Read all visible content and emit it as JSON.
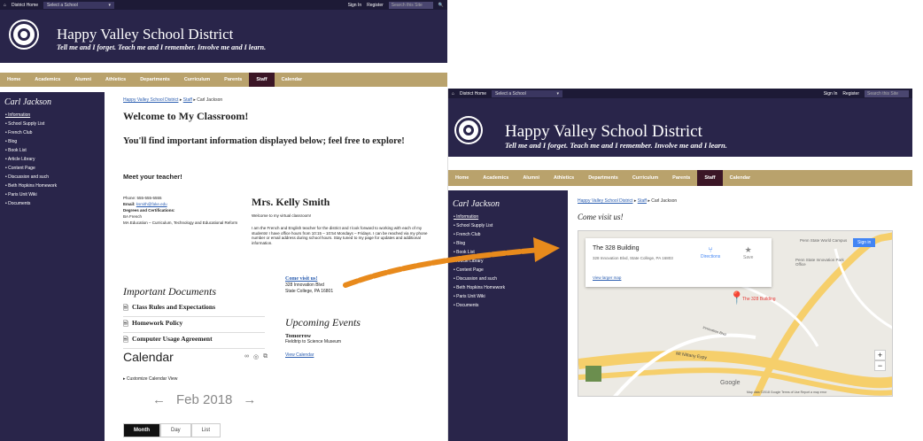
{
  "topbar": {
    "district_home": "District Home",
    "select_school": "Select a School",
    "sign_in": "Sign In",
    "register": "Register",
    "search_placeholder": "Search this Site"
  },
  "banner": {
    "title": "Happy Valley School District",
    "tagline": "Tell me and I forget. Teach me and I remember. Involve me and I learn."
  },
  "nav": [
    "Home",
    "Academics",
    "Alumni",
    "Athletics",
    "Departments",
    "Curriculum",
    "Parents",
    "Staff",
    "Calendar"
  ],
  "sidebar": {
    "title": "Carl Jackson",
    "items": [
      "Information",
      "School Supply List",
      "French Club",
      "Blog",
      "Book List",
      "Article Library",
      "Content Page",
      "Discussion and such",
      "Beth Hopkins Homework",
      "Paris Unit Wiki",
      "Documents"
    ]
  },
  "breadcrumb": {
    "root": "Happy Valley School District",
    "sep": "▸",
    "staff": "Staff",
    "current": "Carl Jackson"
  },
  "classroom": {
    "welcome": "Welcome to My Classroom!",
    "info_heading": "You'll find important information displayed below; feel free to explore!",
    "meet": "Meet your teacher!",
    "phone": "Phone: 555-555-5555",
    "email_label": "Email:",
    "email": "ksmith@fake.edu",
    "degrees": "Degrees and Certifications:",
    "degree1": "BA French",
    "degree2": "MA Education – Curriculum, Technology and Educational Reform",
    "teacher_name": "Mrs. Kelly Smith",
    "welcome_msg": "Welcome to my virtual classroom!",
    "bio": "I am the French and English teacher for the district and I look forward to working with each of my students! I have office hours from 10:15 – 10:54 Mondays – Fridays. I can be reached via my phone number or email address during school hours. Stay tuned to my page for updates and additional information."
  },
  "visit": {
    "link": "Come visit us!",
    "addr1": "328 Innovation Blvd",
    "addr2": "State College, PA 16801"
  },
  "documents": {
    "heading": "Important Documents",
    "items": [
      "Class Rules and Expectations",
      "Homework Policy",
      "Computer Usage Agreement"
    ]
  },
  "events": {
    "heading": "Upcoming Events",
    "day": "Tomorrow",
    "event": "Fieldtrip to Science Museum",
    "link": "View Calendar"
  },
  "calendar": {
    "heading": "Calendar",
    "customize": "Customize Calendar View",
    "prev": "←",
    "month": "Feb 2018",
    "next": "→",
    "views": [
      "Month",
      "Day",
      "List"
    ]
  },
  "map": {
    "place": "The 328 Building",
    "address": "328 Innovation Blvd, State College, PA 16803",
    "directions": "Directions",
    "save": "Save",
    "view_larger": "View larger map",
    "sign_in": "Sign in",
    "pin_label": "The 328 Building",
    "poi1": "Penn State World Campus",
    "poi2": "Penn State Innovation Park Office",
    "road1": "Innovation Blvd",
    "road2": "Mt Nittany Expy",
    "zoom_in": "+",
    "zoom_out": "−",
    "google": "Google",
    "footer": "Map data ©2018 Google   Terms of Use   Report a map error"
  },
  "colors": {
    "header": "#29254a",
    "nav": "#b9a26c",
    "nav_active": "#3b1626",
    "link": "#2a5db0",
    "arrow": "#e88a1c",
    "pin": "#e53935"
  }
}
